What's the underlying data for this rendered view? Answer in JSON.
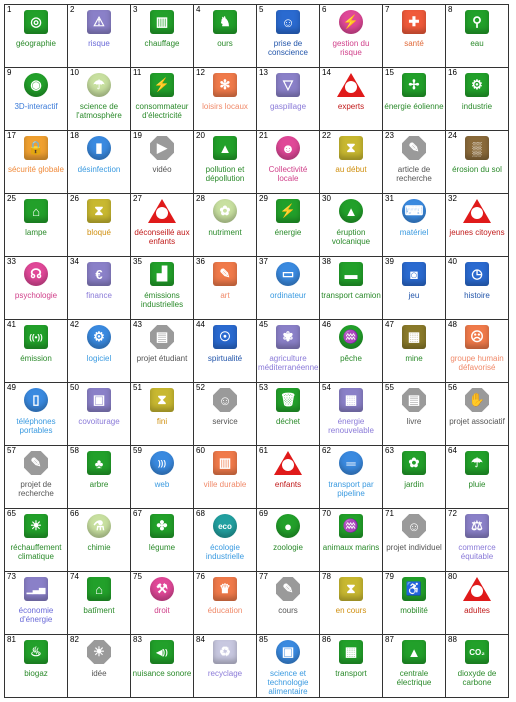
{
  "cells": [
    {
      "n": "1",
      "label": "géographie",
      "color": "#2a8a2a",
      "shape": "sq",
      "bg": "#22a02a",
      "glyph": "◎",
      "icon": "globe-icon"
    },
    {
      "n": "2",
      "label": "risque",
      "color": "#6a6ad8",
      "shape": "sq",
      "bg": "#8a80c8",
      "glyph": "⚠",
      "icon": "warning-icon"
    },
    {
      "n": "3",
      "label": "chauffage",
      "color": "#2a8a2a",
      "shape": "sq",
      "bg": "#22a02a",
      "glyph": "▥",
      "icon": "radiator-icon"
    },
    {
      "n": "4",
      "label": "ours",
      "color": "#2a8a2a",
      "shape": "sq",
      "bg": "#22a02a",
      "glyph": "♞",
      "icon": "bear-icon"
    },
    {
      "n": "5",
      "label": "prise de conscience",
      "color": "#2255aa",
      "shape": "sq",
      "bg": "#2a6ad0",
      "glyph": "☺",
      "icon": "reading-person-icon"
    },
    {
      "n": "6",
      "label": "gestion du risque",
      "color": "#d0408a",
      "shape": "circ",
      "bg": "#e04898",
      "glyph": "⚡",
      "icon": "lightning-icon"
    },
    {
      "n": "7",
      "label": "santé",
      "color": "#e06a3a",
      "shape": "sq",
      "bg": "#f05a3a",
      "glyph": "✚",
      "icon": "health-cross-icon"
    },
    {
      "n": "8",
      "label": "eau",
      "color": "#2a8a2a",
      "shape": "sq",
      "bg": "#22a02a",
      "glyph": "⚲",
      "icon": "faucet-icon"
    },
    {
      "n": "9",
      "label": "3D-interactif",
      "color": "#3a7ad8",
      "shape": "circ",
      "bg": "#22a02a",
      "glyph": "◉",
      "icon": "torus-3d-icon"
    },
    {
      "n": "10",
      "label": "science de l'atmosphère",
      "color": "#2a8a2a",
      "shape": "circ",
      "bg": "#c8e0a0",
      "glyph": "☂",
      "icon": "atmosphere-icon"
    },
    {
      "n": "11",
      "label": "consommateur d'électricité",
      "color": "#2a8a2a",
      "shape": "sq",
      "bg": "#22a02a",
      "glyph": "⚡",
      "icon": "plug-icon"
    },
    {
      "n": "12",
      "label": "loisirs locaux",
      "color": "#f08a6a",
      "shape": "sq",
      "bg": "#f07a4a",
      "glyph": "✻",
      "icon": "palm-tree-icon"
    },
    {
      "n": "13",
      "label": "gaspillage",
      "color": "#8a7ad8",
      "shape": "sq",
      "bg": "#8a80c8",
      "glyph": "▽",
      "icon": "waste-bin-icon"
    },
    {
      "n": "14",
      "label": "experts",
      "color": "#c01a1a",
      "shape": "tri",
      "bg": "#e01a1a",
      "glyph": "",
      "icon": "expert-person-icon"
    },
    {
      "n": "15",
      "label": "énergie éolienne",
      "color": "#2a8a2a",
      "shape": "sq",
      "bg": "#22a02a",
      "glyph": "✢",
      "icon": "wind-turbine-icon"
    },
    {
      "n": "16",
      "label": "industrie",
      "color": "#2a8a2a",
      "shape": "sq",
      "bg": "#22a02a",
      "glyph": "⚙",
      "icon": "gears-icon"
    },
    {
      "n": "17",
      "label": "sécurité globale",
      "color": "#f08a3a",
      "shape": "sq",
      "bg": "#f0a030",
      "glyph": "🔒",
      "icon": "padlock-icon"
    },
    {
      "n": "18",
      "label": "désinfection",
      "color": "#3a9ae0",
      "shape": "circ",
      "bg": "#3a8ae0",
      "glyph": "▮",
      "icon": "spray-bottle-icon"
    },
    {
      "n": "19",
      "label": "vidéo",
      "color": "#555555",
      "shape": "oct",
      "bg": "#9a9a9a",
      "glyph": "▶",
      "icon": "video-camera-icon"
    },
    {
      "n": "20",
      "label": "pollution et dépollution",
      "color": "#2a8a2a",
      "shape": "sq",
      "bg": "#22a02a",
      "glyph": "▲",
      "icon": "factory-icon"
    },
    {
      "n": "21",
      "label": "Collectivité locale",
      "color": "#d0408a",
      "shape": "circ",
      "bg": "#e04898",
      "glyph": "☻",
      "icon": "community-icon"
    },
    {
      "n": "22",
      "label": "au début",
      "color": "#d09010",
      "shape": "sq",
      "bg": "#c8b830",
      "glyph": "⧗",
      "icon": "hourglass-start-icon"
    },
    {
      "n": "23",
      "label": "article de recherche",
      "color": "#555555",
      "shape": "oct",
      "bg": "#9a9a9a",
      "glyph": "✎",
      "icon": "research-article-icon"
    },
    {
      "n": "24",
      "label": "érosion du sol",
      "color": "#2a8a2a",
      "shape": "sq",
      "bg": "#8a6a3a",
      "glyph": "▒",
      "icon": "soil-icon"
    },
    {
      "n": "25",
      "label": "lampe",
      "color": "#2a8a2a",
      "shape": "sq",
      "bg": "#22a02a",
      "glyph": "⌂",
      "icon": "lamp-icon"
    },
    {
      "n": "26",
      "label": "bloqué",
      "color": "#d09010",
      "shape": "sq",
      "bg": "#c8b830",
      "glyph": "⧗",
      "icon": "hourglass-blocked-icon"
    },
    {
      "n": "27",
      "label": "déconseillé aux enfants",
      "color": "#c01a1a",
      "shape": "tri",
      "bg": "#e01a1a",
      "glyph": "",
      "icon": "not-for-children-icon"
    },
    {
      "n": "28",
      "label": "nutriment",
      "color": "#2a8a2a",
      "shape": "circ",
      "bg": "#c8e0a0",
      "glyph": "✿",
      "icon": "nutrient-icon"
    },
    {
      "n": "29",
      "label": "énergie",
      "color": "#2a8a2a",
      "shape": "sq",
      "bg": "#22a02a",
      "glyph": "⚡",
      "icon": "power-plug-icon"
    },
    {
      "n": "30",
      "label": "éruption volcanique",
      "color": "#2a8a2a",
      "shape": "circ",
      "bg": "#22a02a",
      "glyph": "▲",
      "icon": "volcano-icon"
    },
    {
      "n": "31",
      "label": "matériel",
      "color": "#3a9ae0",
      "shape": "circ",
      "bg": "#3a8ae0",
      "glyph": "⌨",
      "icon": "hardware-icon"
    },
    {
      "n": "32",
      "label": "jeunes citoyens",
      "color": "#c01a1a",
      "shape": "tri",
      "bg": "#e01a1a",
      "glyph": "",
      "icon": "young-citizens-icon"
    },
    {
      "n": "33",
      "label": "psychologie",
      "color": "#d0408a",
      "shape": "circ",
      "bg": "#e04898",
      "glyph": "☊",
      "icon": "psychology-icon"
    },
    {
      "n": "34",
      "label": "finance",
      "color": "#8a7ad8",
      "shape": "sq",
      "bg": "#8a80c8",
      "glyph": "€",
      "icon": "euro-icon"
    },
    {
      "n": "35",
      "label": "émissions industrielles",
      "color": "#2a8a2a",
      "shape": "sq",
      "bg": "#22a02a",
      "glyph": "▟",
      "icon": "industrial-emissions-icon"
    },
    {
      "n": "36",
      "label": "art",
      "color": "#f08a6a",
      "shape": "sq",
      "bg": "#f07a4a",
      "glyph": "✎",
      "icon": "art-palette-icon"
    },
    {
      "n": "37",
      "label": "ordinateur",
      "color": "#3a9ae0",
      "shape": "circ",
      "bg": "#3a8ae0",
      "glyph": "▭",
      "icon": "computer-icon"
    },
    {
      "n": "38",
      "label": "transport camion",
      "color": "#2a8a2a",
      "shape": "sq",
      "bg": "#22a02a",
      "glyph": "▬",
      "icon": "truck-icon"
    },
    {
      "n": "39",
      "label": "jeu",
      "color": "#2255aa",
      "shape": "sq",
      "bg": "#2a6ad0",
      "glyph": "◙",
      "icon": "gamepad-icon"
    },
    {
      "n": "40",
      "label": "histoire",
      "color": "#2255aa",
      "shape": "sq",
      "bg": "#2a6ad0",
      "glyph": "◷",
      "icon": "history-clock-icon"
    },
    {
      "n": "41",
      "label": "émission",
      "color": "#2a8a2a",
      "shape": "sq",
      "bg": "#22a02a",
      "glyph": "((•))",
      "icon": "broadcast-icon"
    },
    {
      "n": "42",
      "label": "logiciel",
      "color": "#3a9ae0",
      "shape": "circ",
      "bg": "#3a8ae0",
      "glyph": "⚙",
      "icon": "software-gear-icon"
    },
    {
      "n": "43",
      "label": "projet étudiant",
      "color": "#555555",
      "shape": "oct",
      "bg": "#9a9a9a",
      "glyph": "▤",
      "icon": "student-project-icon"
    },
    {
      "n": "44",
      "label": "spirtualité",
      "color": "#2255aa",
      "shape": "sq",
      "bg": "#2a6ad0",
      "glyph": "☉",
      "icon": "spirituality-icon"
    },
    {
      "n": "45",
      "label": "agriculture méditerranéenne",
      "color": "#8a7ad8",
      "shape": "sq",
      "bg": "#8a80c8",
      "glyph": "✾",
      "icon": "wheat-icon"
    },
    {
      "n": "46",
      "label": "pêche",
      "color": "#2a8a2a",
      "shape": "circ",
      "bg": "#22a02a",
      "glyph": "♒",
      "icon": "fish-icon"
    },
    {
      "n": "47",
      "label": "mine",
      "color": "#2a8a2a",
      "shape": "sq",
      "bg": "#8a7a2a",
      "glyph": "▦",
      "icon": "mine-cart-icon"
    },
    {
      "n": "48",
      "label": "groupe humain défavorisé",
      "color": "#f08a6a",
      "shape": "sq",
      "bg": "#f07a4a",
      "glyph": "☹",
      "icon": "disadvantaged-group-icon"
    },
    {
      "n": "49",
      "label": "téléphones portables",
      "color": "#3a9ae0",
      "shape": "circ",
      "bg": "#3a8ae0",
      "glyph": "▯",
      "icon": "mobile-phone-icon"
    },
    {
      "n": "50",
      "label": "covoiturage",
      "color": "#8a7ad8",
      "shape": "sq",
      "bg": "#8a80c8",
      "glyph": "▣",
      "icon": "carpool-icon"
    },
    {
      "n": "51",
      "label": "fini",
      "color": "#d09010",
      "shape": "sq",
      "bg": "#c8b830",
      "glyph": "⧗",
      "icon": "hourglass-finished-icon"
    },
    {
      "n": "52",
      "label": "service",
      "color": "#555555",
      "shape": "oct",
      "bg": "#9a9a9a",
      "glyph": "☺",
      "icon": "service-icon"
    },
    {
      "n": "53",
      "label": "déchet",
      "color": "#2a8a2a",
      "shape": "sq",
      "bg": "#22a02a",
      "glyph": "🗑",
      "icon": "trash-icon"
    },
    {
      "n": "54",
      "label": "énergie renouvelable",
      "color": "#8a7ad8",
      "shape": "sq",
      "bg": "#8a80c8",
      "glyph": "▦",
      "icon": "solar-panel-icon"
    },
    {
      "n": "55",
      "label": "livre",
      "color": "#555555",
      "shape": "oct",
      "bg": "#9a9a9a",
      "glyph": "▤",
      "icon": "book-icon"
    },
    {
      "n": "56",
      "label": "projet associatif",
      "color": "#555555",
      "shape": "oct",
      "bg": "#9a9a9a",
      "glyph": "✋",
      "icon": "handshake-icon"
    },
    {
      "n": "57",
      "label": "projet de recherche",
      "color": "#555555",
      "shape": "oct",
      "bg": "#9a9a9a",
      "glyph": "✎",
      "icon": "research-project-icon"
    },
    {
      "n": "58",
      "label": "arbre",
      "color": "#2a8a2a",
      "shape": "sq",
      "bg": "#22a02a",
      "glyph": "♣",
      "icon": "tree-icon"
    },
    {
      "n": "59",
      "label": "web",
      "color": "#3a9ae0",
      "shape": "circ",
      "bg": "#3a8ae0",
      "glyph": ")))",
      "icon": "web-feed-icon"
    },
    {
      "n": "60",
      "label": "ville durable",
      "color": "#f08a6a",
      "shape": "sq",
      "bg": "#f07a4a",
      "glyph": "▥",
      "icon": "sustainable-city-icon"
    },
    {
      "n": "61",
      "label": "enfants",
      "color": "#c01a1a",
      "shape": "tri",
      "bg": "#e01a1a",
      "glyph": "",
      "icon": "children-icon"
    },
    {
      "n": "62",
      "label": "transport par pipeline",
      "color": "#3a9ae0",
      "shape": "circ",
      "bg": "#3a8ae0",
      "glyph": "═",
      "icon": "pipeline-icon"
    },
    {
      "n": "63",
      "label": "jardin",
      "color": "#2a8a2a",
      "shape": "sq",
      "bg": "#22a02a",
      "glyph": "✿",
      "icon": "garden-flower-icon"
    },
    {
      "n": "64",
      "label": "pluie",
      "color": "#2a8a2a",
      "shape": "sq",
      "bg": "#22a02a",
      "glyph": "☂",
      "icon": "rain-icon"
    },
    {
      "n": "65",
      "label": "réchauffement climatique",
      "color": "#2a8a2a",
      "shape": "sq",
      "bg": "#22a02a",
      "glyph": "☀",
      "icon": "global-warming-icon"
    },
    {
      "n": "66",
      "label": "chimie",
      "color": "#2a8a2a",
      "shape": "circ",
      "bg": "#c8e0a0",
      "glyph": "⚗",
      "icon": "chemistry-icon"
    },
    {
      "n": "67",
      "label": "légume",
      "color": "#2a8a2a",
      "shape": "sq",
      "bg": "#22a02a",
      "glyph": "✤",
      "icon": "vegetable-icon"
    },
    {
      "n": "68",
      "label": "écologie industrielle",
      "color": "#3a9ae0",
      "shape": "circ",
      "bg": "#22a0a0",
      "glyph": "eco",
      "icon": "eco-icon"
    },
    {
      "n": "69",
      "label": "zoologie",
      "color": "#2a8a2a",
      "shape": "circ",
      "bg": "#22a02a",
      "glyph": "●",
      "icon": "panda-icon"
    },
    {
      "n": "70",
      "label": "animaux marins",
      "color": "#2a8a2a",
      "shape": "sq",
      "bg": "#22a02a",
      "glyph": "♒",
      "icon": "marine-animal-icon"
    },
    {
      "n": "71",
      "label": "projet individuel",
      "color": "#555555",
      "shape": "oct",
      "bg": "#9a9a9a",
      "glyph": "☺",
      "icon": "individual-project-icon"
    },
    {
      "n": "72",
      "label": "commerce équitable",
      "color": "#8a7ad8",
      "shape": "sq",
      "bg": "#8a80c8",
      "glyph": "⚖",
      "icon": "scales-icon"
    },
    {
      "n": "73",
      "label": "économie d'énergie",
      "color": "#6a6ad8",
      "shape": "sq",
      "bg": "#8a80c8",
      "glyph": "▁▃▅",
      "icon": "energy-saving-icon"
    },
    {
      "n": "74",
      "label": "batîment",
      "color": "#2a8a2a",
      "shape": "sq",
      "bg": "#22a02a",
      "glyph": "⌂",
      "icon": "building-icon"
    },
    {
      "n": "75",
      "label": "droit",
      "color": "#d0408a",
      "shape": "circ",
      "bg": "#e04898",
      "glyph": "⚒",
      "icon": "gavel-icon"
    },
    {
      "n": "76",
      "label": "éducation",
      "color": "#f08a6a",
      "shape": "sq",
      "bg": "#f07a4a",
      "glyph": "♛",
      "icon": "graduation-cap-icon"
    },
    {
      "n": "77",
      "label": "cours",
      "color": "#555555",
      "shape": "oct",
      "bg": "#9a9a9a",
      "glyph": "✎",
      "icon": "course-icon"
    },
    {
      "n": "78",
      "label": "en cours",
      "color": "#d09010",
      "shape": "sq",
      "bg": "#c8b830",
      "glyph": "⧗",
      "icon": "hourglass-in-progress-icon"
    },
    {
      "n": "79",
      "label": "mobilité",
      "color": "#2a8a2a",
      "shape": "sq",
      "bg": "#22a02a",
      "glyph": "♿",
      "icon": "mobility-icon"
    },
    {
      "n": "80",
      "label": "adultes",
      "color": "#c01a1a",
      "shape": "tri",
      "bg": "#e01a1a",
      "glyph": "",
      "icon": "adults-icon"
    },
    {
      "n": "81",
      "label": "biogaz",
      "color": "#2a8a2a",
      "shape": "sq",
      "bg": "#22a02a",
      "glyph": "♨",
      "icon": "biogas-icon"
    },
    {
      "n": "82",
      "label": "idée",
      "color": "#555555",
      "shape": "oct",
      "bg": "#9a9a9a",
      "glyph": "☀",
      "icon": "lightbulb-icon"
    },
    {
      "n": "83",
      "label": "nuisance sonore",
      "color": "#2a8a2a",
      "shape": "sq",
      "bg": "#22a02a",
      "glyph": "◀))",
      "icon": "speaker-icon"
    },
    {
      "n": "84",
      "label": "recyclage",
      "color": "#8a7ad8",
      "shape": "sq",
      "bg": "#c8c8e0",
      "glyph": "♻",
      "icon": "recycle-icon"
    },
    {
      "n": "85",
      "label": "science et technologie alimentaire",
      "color": "#3a9ae0",
      "shape": "circ",
      "bg": "#3a8ae0",
      "glyph": "▣",
      "icon": "food-tech-icon"
    },
    {
      "n": "86",
      "label": "transport",
      "color": "#2a8a2a",
      "shape": "sq",
      "bg": "#22a02a",
      "glyph": "▦",
      "icon": "train-icon"
    },
    {
      "n": "87",
      "label": "centrale électrique",
      "color": "#2a8a2a",
      "shape": "sq",
      "bg": "#22a02a",
      "glyph": "▲",
      "icon": "power-plant-icon"
    },
    {
      "n": "88",
      "label": "dioxyde de carbone",
      "color": "#2a8a2a",
      "shape": "sq",
      "bg": "#22a02a",
      "glyph": "CO₂",
      "icon": "co2-icon"
    }
  ]
}
